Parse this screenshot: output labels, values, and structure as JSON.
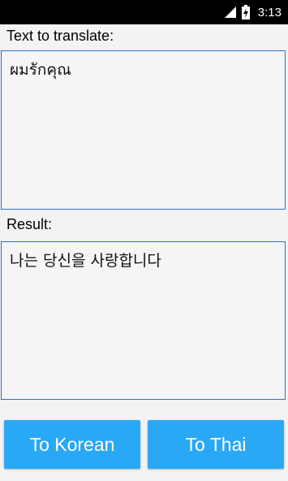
{
  "status_bar": {
    "time": "3:13",
    "icons": [
      "signal-icon",
      "battery-charging-icon"
    ]
  },
  "source": {
    "label": "Text to translate:",
    "value": "ผมรักคุณ"
  },
  "result": {
    "label": "Result:",
    "value": "나는 당신을 사랑합니다"
  },
  "buttons": {
    "to_korean": "To Korean",
    "to_thai": "To Thai"
  },
  "colors": {
    "accent_border": "#2f6fc6",
    "button_bg": "#29a8f5",
    "button_text": "#ffffff",
    "background": "#f3f3f3",
    "status_bar_bg": "#000000"
  }
}
